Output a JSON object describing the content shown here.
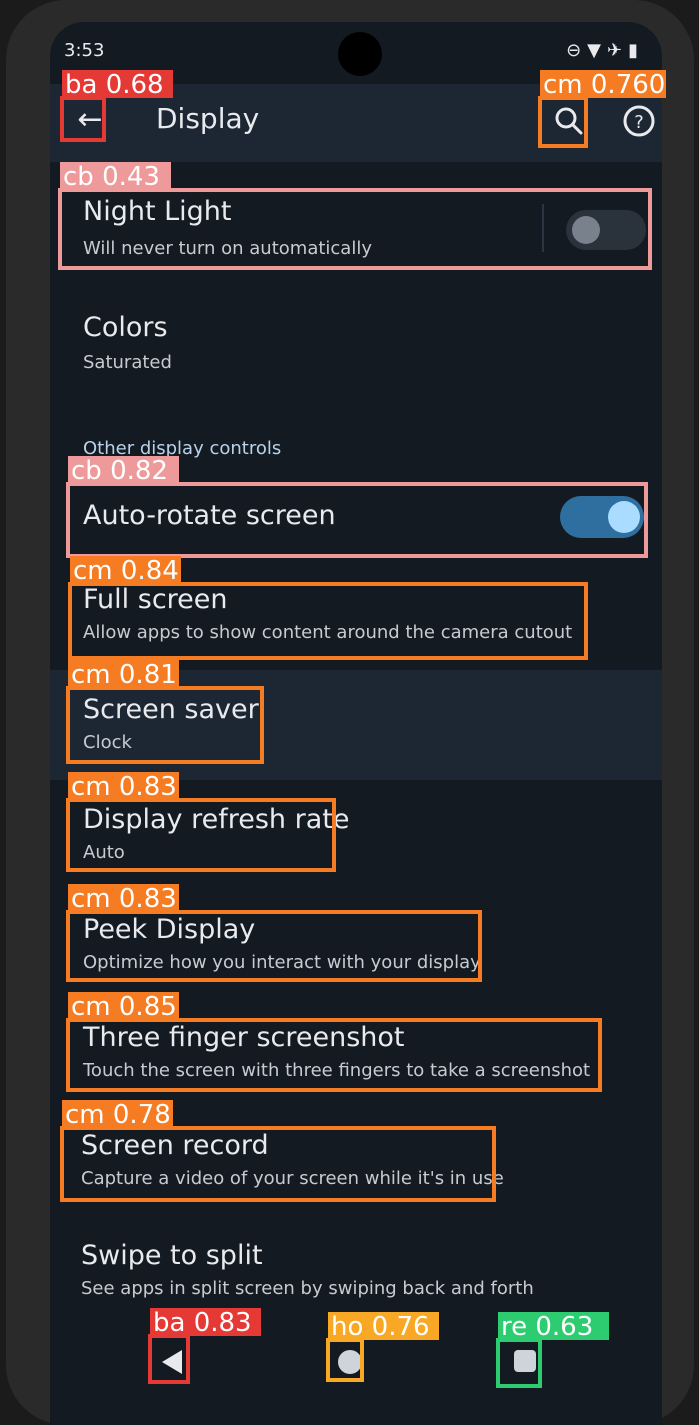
{
  "status_bar": {
    "time": "3:53",
    "icons": [
      "dnd-icon",
      "wifi-icon",
      "airplane-icon",
      "battery-icon"
    ]
  },
  "appbar": {
    "title": "Display"
  },
  "items": {
    "night_light": {
      "title": "Night Light",
      "subtitle": "Will never turn on automatically",
      "toggle": false
    },
    "colors": {
      "title": "Colors",
      "subtitle": "Saturated"
    },
    "section_other": "Other display controls",
    "auto_rotate": {
      "title": "Auto-rotate screen",
      "toggle": true
    },
    "full_screen": {
      "title": "Full screen",
      "subtitle": "Allow apps to show content around the camera cutout"
    },
    "screen_saver": {
      "title": "Screen saver",
      "subtitle": "Clock"
    },
    "refresh_rate": {
      "title": "Display refresh rate",
      "subtitle": "Auto"
    },
    "peek_display": {
      "title": "Peek Display",
      "subtitle": "Optimize how you interact with your display"
    },
    "three_finger": {
      "title": "Three finger screenshot",
      "subtitle": "Touch the screen with three fingers to take a screenshot"
    },
    "screen_record": {
      "title": "Screen record",
      "subtitle": "Capture a video of your screen while it's in use"
    },
    "swipe_split": {
      "title": "Swipe to split",
      "subtitle": "See apps in split screen by swiping back and forth"
    }
  },
  "overlays": [
    {
      "tag": "ba 0.68",
      "color": "#e53935"
    },
    {
      "tag": "cm 0.760",
      "color": "#f57c22"
    },
    {
      "tag": "cb 0.43",
      "color": "#ef9a9a"
    },
    {
      "tag": "cb 0.82",
      "color": "#ef9a9a"
    },
    {
      "tag": "cm 0.84",
      "color": "#f57c22"
    },
    {
      "tag": "cm 0.81",
      "color": "#f57c22"
    },
    {
      "tag": "cm 0.83",
      "color": "#f57c22"
    },
    {
      "tag": "cm 0.83",
      "color": "#f57c22"
    },
    {
      "tag": "cm 0.85",
      "color": "#f57c22"
    },
    {
      "tag": "cm 0.78",
      "color": "#f57c22"
    },
    {
      "tag": "ba 0.83",
      "color": "#e53935"
    },
    {
      "tag": "ho 0.76",
      "color": "#f9a825"
    },
    {
      "tag": "re 0.63",
      "color": "#2ecc71"
    }
  ],
  "colors": {
    "background": "#141a22",
    "appbar": "#1d2733",
    "accent": "#2f6f9f",
    "toggle_knob_on": "#a9dcff"
  }
}
